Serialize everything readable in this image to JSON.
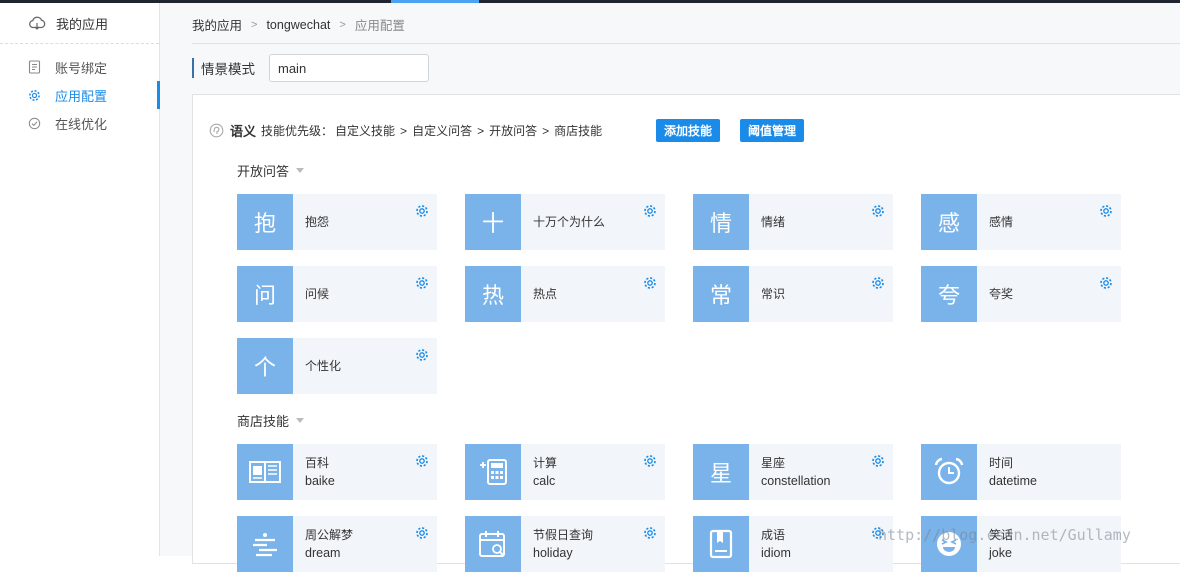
{
  "sidebar": {
    "header": "我的应用",
    "items": [
      {
        "label": "账号绑定",
        "icon": "doc-icon",
        "active": false
      },
      {
        "label": "应用配置",
        "icon": "gear-icon",
        "active": true
      },
      {
        "label": "在线优化",
        "icon": "check-circle-icon",
        "active": false
      }
    ]
  },
  "breadcrumb": [
    "我的应用",
    "tongwechat",
    "应用配置"
  ],
  "breadcrumb_sep": ">",
  "scene": {
    "label": "情景模式",
    "value": "main"
  },
  "semantic": {
    "title": "语义",
    "priority_label": "技能优先级：",
    "chain": [
      "自定义技能",
      "自定义问答",
      "开放问答",
      "商店技能"
    ],
    "chain_sep": ">",
    "add_button": "添加技能",
    "threshold_button": "阈值管理"
  },
  "sections": [
    {
      "title": "开放问答",
      "cards": [
        {
          "glyph": "抱",
          "name": "抱怨"
        },
        {
          "glyph": "十",
          "name": "十万个为什么"
        },
        {
          "glyph": "情",
          "name": "情绪"
        },
        {
          "glyph": "感",
          "name": "感情"
        },
        {
          "glyph": "问",
          "name": "问候"
        },
        {
          "glyph": "热",
          "name": "热点"
        },
        {
          "glyph": "常",
          "name": "常识"
        },
        {
          "glyph": "夸",
          "name": "夸奖"
        },
        {
          "glyph": "个",
          "name": "个性化"
        }
      ]
    },
    {
      "title": "商店技能",
      "cards": [
        {
          "icon": "book-icon",
          "name": "百科",
          "en": "baike"
        },
        {
          "icon": "calculator-icon",
          "name": "计算",
          "en": "calc"
        },
        {
          "glyph": "星",
          "name": "星座",
          "en": "constellation"
        },
        {
          "icon": "alarm-clock-icon",
          "name": "时间",
          "en": "datetime"
        },
        {
          "icon": "dream-icon",
          "name": "周公解梦",
          "en": "dream"
        },
        {
          "icon": "calendar-search-icon",
          "name": "节假日查询",
          "en": "holiday"
        },
        {
          "icon": "idiom-book-icon",
          "name": "成语",
          "en": "idiom"
        },
        {
          "icon": "laugh-face-icon",
          "name": "笑话",
          "en": "joke"
        }
      ]
    }
  ],
  "watermark": "http://blog.csdn.net/Gullamy",
  "colors": {
    "accent": "#1a8be8",
    "icon_tile": "#7ab3ea",
    "card_bg": "#f2f6fa"
  }
}
